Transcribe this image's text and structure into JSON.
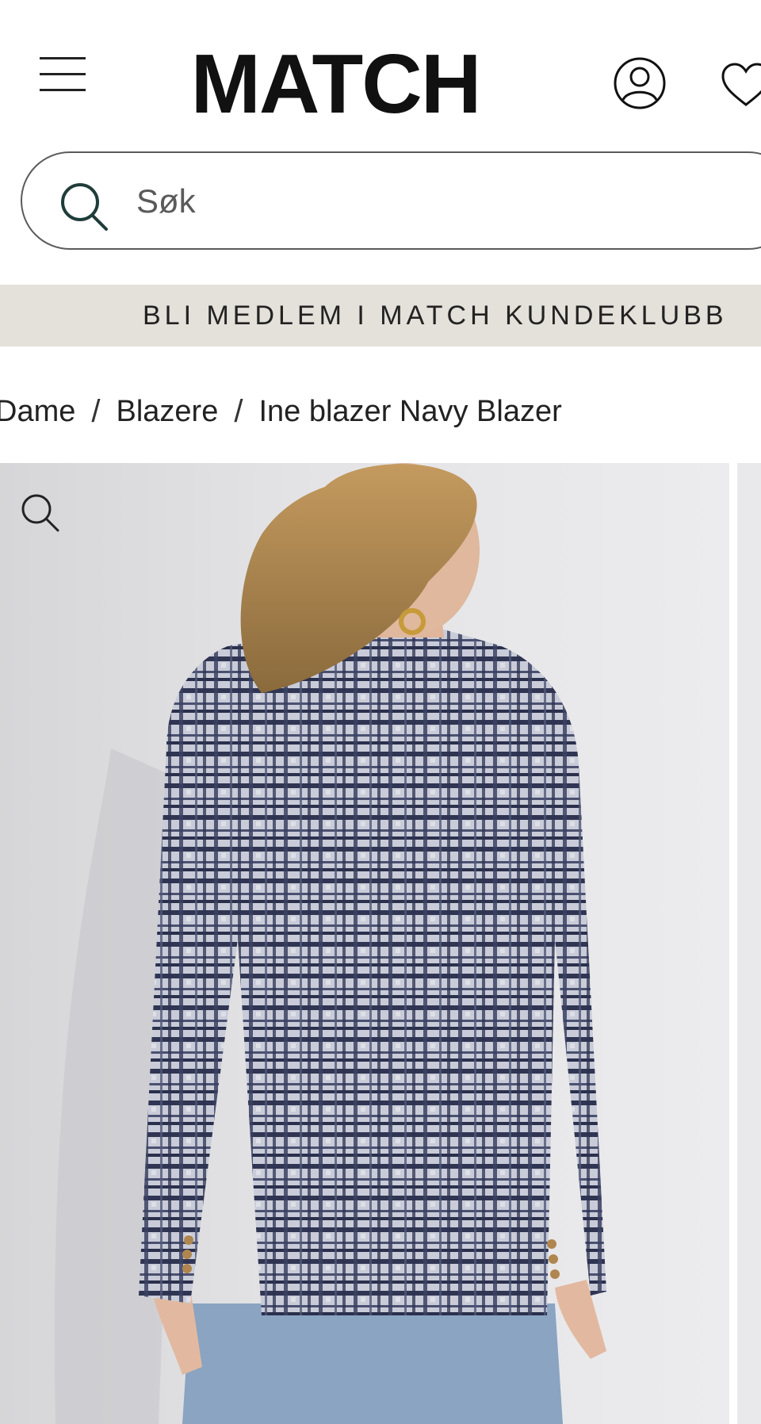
{
  "header": {
    "logo_text": "MATCH",
    "menu_icon": "hamburger-menu-icon",
    "account_icon": "user-circle-icon",
    "wishlist_icon": "heart-icon"
  },
  "search": {
    "placeholder": "Søk",
    "icon": "search-icon"
  },
  "promo": {
    "text": "BLI MEDLEM I MATCH KUNDEKLUBB"
  },
  "breadcrumb": {
    "items": [
      "Dame",
      "Blazere",
      "Ine blazer Navy Blazer"
    ],
    "separator": "/"
  },
  "gallery": {
    "zoom_icon": "zoom-icon",
    "image_subject": "Model wearing navy checked tweed blazer, back view"
  },
  "colors": {
    "promo_bg": "#e4e0da",
    "image_bg": "#e3e3e5",
    "search_icon": "#1f3d3a",
    "text": "#1b1b1b"
  }
}
